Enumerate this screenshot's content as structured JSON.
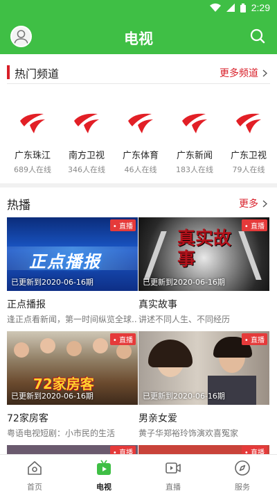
{
  "status_bar": {
    "time": "2:29"
  },
  "header": {
    "title": "电视"
  },
  "hot_channels": {
    "title": "热门频道",
    "more": "更多频道",
    "items": [
      {
        "name": "广东珠江",
        "online": "689人在线"
      },
      {
        "name": "南方卫视",
        "online": "346人在线"
      },
      {
        "name": "广东体育",
        "online": "46人在线"
      },
      {
        "name": "广东新闻",
        "online": "183人在线"
      },
      {
        "name": "广东卫视",
        "online": "79人在线"
      }
    ]
  },
  "hot_broadcast": {
    "title": "热播",
    "more": "更多",
    "live_label": "直播",
    "cards": [
      {
        "title": "正点播报",
        "desc": "逢正点看新闻，第一时间纵览全球...",
        "updated": "已更新到2020-06-16期",
        "thumb_text": "正点播报"
      },
      {
        "title": "真实故事",
        "desc": "讲述不同人生、不同经历",
        "updated": "已更新到2020-06-16期",
        "thumb_text": "真实故事"
      },
      {
        "title": "72家房客",
        "desc": "粤语电视短剧：小市民的生活",
        "updated": "已更新到2020-06-16期",
        "thumb_text": "72家房客"
      },
      {
        "title": "男亲女爱",
        "desc": "黄子华郑裕玲饰演欢喜冤家",
        "updated": "已更新到2020-06-16期",
        "thumb_text": ""
      }
    ]
  },
  "bottom_nav": {
    "items": [
      {
        "label": "首页"
      },
      {
        "label": "电视"
      },
      {
        "label": "直播"
      },
      {
        "label": "服务"
      }
    ]
  },
  "colors": {
    "brand_green": "#3fbf45",
    "accent_red": "#d81e28",
    "live_red": "#e53a3a"
  }
}
